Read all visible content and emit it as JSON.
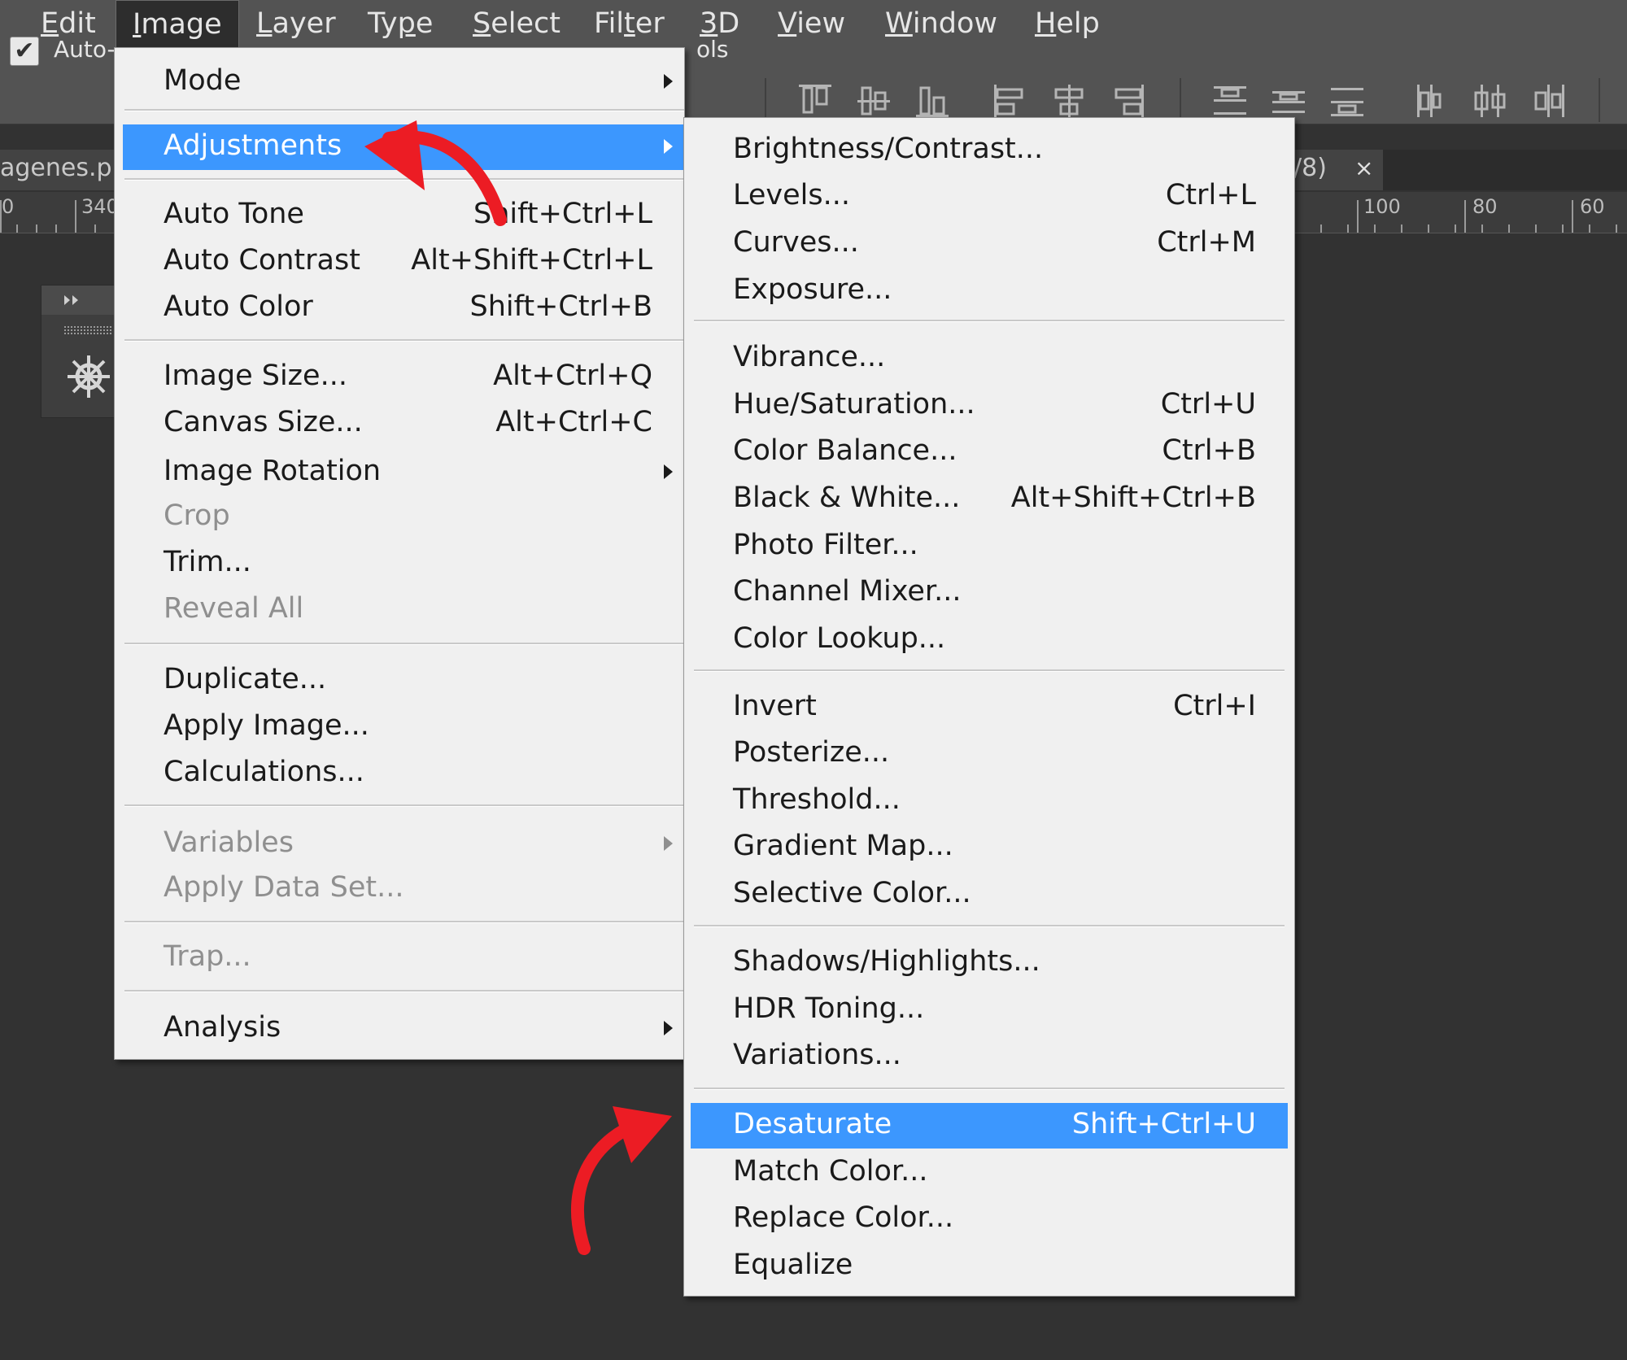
{
  "menubar": {
    "items": [
      {
        "pre": "",
        "ul": "E",
        "post": "dit"
      },
      {
        "pre": "",
        "ul": "I",
        "post": "mage"
      },
      {
        "pre": "",
        "ul": "L",
        "post": "ayer"
      },
      {
        "pre": "Ty",
        "ul": "p",
        "post": "e"
      },
      {
        "pre": "",
        "ul": "S",
        "post": "elect"
      },
      {
        "pre": "Fil",
        "ul": "t",
        "post": "er"
      },
      {
        "pre": "",
        "ul": "3",
        "post": "D"
      },
      {
        "pre": "",
        "ul": "V",
        "post": "iew"
      },
      {
        "pre": "",
        "ul": "W",
        "post": "indow"
      },
      {
        "pre": "",
        "ul": "H",
        "post": "elp"
      }
    ]
  },
  "options": {
    "auto_label": "Auto-",
    "checked": "✔",
    "controls_fragment": "ols"
  },
  "document": {
    "tab_left": "agenes.p",
    "tab_right": "/8)",
    "tab_close": "×",
    "ruler_left": [
      "0",
      "340"
    ],
    "ruler_right": [
      "100",
      "80",
      "60"
    ]
  },
  "image_menu": {
    "items": [
      {
        "label": "Mode",
        "shortcut": "",
        "submenu": true
      },
      {
        "label": "Adjustments",
        "shortcut": "",
        "submenu": true,
        "highlighted": true
      },
      {
        "label": "Auto Tone",
        "shortcut": "Shift+Ctrl+L"
      },
      {
        "label": "Auto Contrast",
        "shortcut": "Alt+Shift+Ctrl+L"
      },
      {
        "label": "Auto Color",
        "shortcut": "Shift+Ctrl+B"
      },
      {
        "label": "Image Size...",
        "shortcut": "Alt+Ctrl+Q"
      },
      {
        "label": "Canvas Size...",
        "shortcut": "Alt+Ctrl+C"
      },
      {
        "label": "Image Rotation",
        "shortcut": "",
        "submenu": true
      },
      {
        "label": "Crop",
        "shortcut": "",
        "disabled": true
      },
      {
        "label": "Trim...",
        "shortcut": ""
      },
      {
        "label": "Reveal All",
        "shortcut": "",
        "disabled": true
      },
      {
        "label": "Duplicate...",
        "shortcut": ""
      },
      {
        "label": "Apply Image...",
        "shortcut": ""
      },
      {
        "label": "Calculations...",
        "shortcut": ""
      },
      {
        "label": "Variables",
        "shortcut": "",
        "submenu": true,
        "disabled": true
      },
      {
        "label": "Apply Data Set...",
        "shortcut": "",
        "disabled": true
      },
      {
        "label": "Trap...",
        "shortcut": "",
        "disabled": true
      },
      {
        "label": "Analysis",
        "shortcut": "",
        "submenu": true
      }
    ]
  },
  "adjustments_menu": {
    "items": [
      {
        "label": "Brightness/Contrast...",
        "shortcut": ""
      },
      {
        "label": "Levels...",
        "shortcut": "Ctrl+L"
      },
      {
        "label": "Curves...",
        "shortcut": "Ctrl+M"
      },
      {
        "label": "Exposure...",
        "shortcut": ""
      },
      {
        "label": "Vibrance...",
        "shortcut": ""
      },
      {
        "label": "Hue/Saturation...",
        "shortcut": "Ctrl+U"
      },
      {
        "label": "Color Balance...",
        "shortcut": "Ctrl+B"
      },
      {
        "label": "Black & White...",
        "shortcut": "Alt+Shift+Ctrl+B"
      },
      {
        "label": "Photo Filter...",
        "shortcut": ""
      },
      {
        "label": "Channel Mixer...",
        "shortcut": ""
      },
      {
        "label": "Color Lookup...",
        "shortcut": ""
      },
      {
        "label": "Invert",
        "shortcut": "Ctrl+I"
      },
      {
        "label": "Posterize...",
        "shortcut": ""
      },
      {
        "label": "Threshold...",
        "shortcut": ""
      },
      {
        "label": "Gradient Map...",
        "shortcut": ""
      },
      {
        "label": "Selective Color...",
        "shortcut": ""
      },
      {
        "label": "Shadows/Highlights...",
        "shortcut": ""
      },
      {
        "label": "HDR Toning...",
        "shortcut": ""
      },
      {
        "label": "Variations...",
        "shortcut": ""
      },
      {
        "label": "Desaturate",
        "shortcut": "Shift+Ctrl+U",
        "highlighted": true
      },
      {
        "label": "Match Color...",
        "shortcut": ""
      },
      {
        "label": "Replace Color...",
        "shortcut": ""
      },
      {
        "label": "Equalize",
        "shortcut": ""
      }
    ]
  },
  "colors": {
    "highlight": "#3c97fe",
    "annotation_arrow": "#ec1c24",
    "menu_bg": "#f0f0f0"
  }
}
